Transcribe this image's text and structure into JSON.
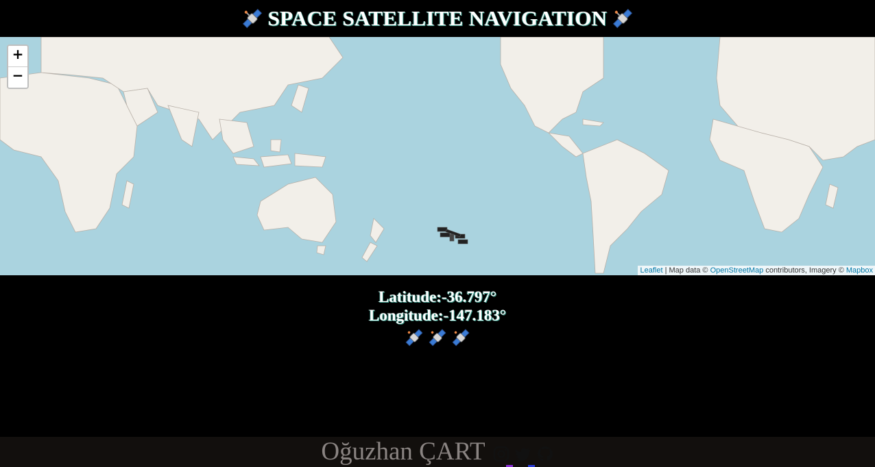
{
  "header": {
    "title": "SPACE SATELLITE NAVIGATION",
    "icon": "satellite-icon"
  },
  "map": {
    "zoom_in_label": "+",
    "zoom_out_label": "−",
    "attribution": {
      "leaflet": "Leaflet",
      "separator": " | Map data © ",
      "osm": "OpenStreetMap",
      "contributors": " contributors, Imagery © ",
      "mapbox": "Mapbox"
    },
    "marker_icon": "iss-icon",
    "colors": {
      "ocean": "#aad3df",
      "land": "#f2efe9",
      "link": "#0078a8"
    }
  },
  "coordinates": {
    "latitude_label": "Latitude:",
    "latitude_value": "-36.797°",
    "longitude_label": "Longitude:",
    "longitude_value": "-147.183°"
  },
  "footer": {
    "author": "Oğuzhan ÇART",
    "links": [
      {
        "name": "instagram-icon",
        "underline": "#8b2fd6"
      },
      {
        "name": "twitter-icon",
        "underline": "#2b3bd6"
      },
      {
        "name": "github-icon",
        "underline": "#000000"
      }
    ]
  }
}
